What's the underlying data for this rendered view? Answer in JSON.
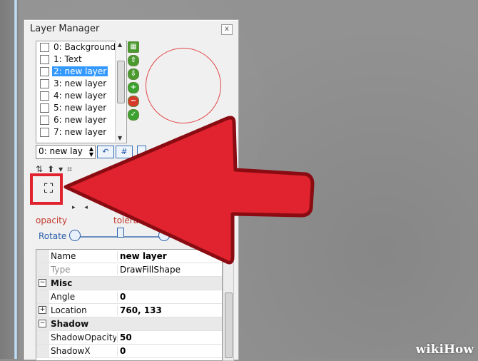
{
  "panel": {
    "title": "Layer Manager",
    "close_glyph": "x"
  },
  "layers": [
    {
      "label": "0: Background",
      "selected": false
    },
    {
      "label": "1: Text",
      "selected": false
    },
    {
      "label": "2: new layer",
      "selected": true
    },
    {
      "label": "3: new layer",
      "selected": false
    },
    {
      "label": "4: new layer",
      "selected": false
    },
    {
      "label": "5: new layer",
      "selected": false
    },
    {
      "label": "6: new layer",
      "selected": false
    },
    {
      "label": "7: new layer",
      "selected": false
    }
  ],
  "layer_select": {
    "value": "0: new lay"
  },
  "buttons": {
    "undo_glyph": "↶",
    "grid_glyph": "#"
  },
  "tools": {
    "icons": [
      "grid-green-icon",
      "arrow-up-green-icon",
      "arrow-down-green-icon",
      "plus-green-icon",
      "minus-red-icon",
      "check-green-icon"
    ],
    "colors": [
      "#4a9a2f",
      "#4a9a2f",
      "#4a9a2f",
      "#3ca22f",
      "#d83a2a",
      "#3ca22f"
    ],
    "glyphs": [
      "▦",
      "⇧",
      "⇩",
      "+",
      "−",
      "✓"
    ]
  },
  "toolbar": {
    "items": [
      "⇅",
      "⬆",
      "▾",
      "⌗"
    ]
  },
  "fill_tool": {
    "glyph": "⛶"
  },
  "labels": {
    "opacity": "opacity",
    "tolerance": "tolerance",
    "rotate": "Rotate"
  },
  "properties": [
    {
      "kind": "row",
      "name": "Name",
      "value": "new layer",
      "bold": true,
      "dim": false
    },
    {
      "kind": "row",
      "name": "Type",
      "value": "DrawFillShape",
      "bold": false,
      "dim": true
    },
    {
      "kind": "cat",
      "name": "Misc",
      "toggle": "−"
    },
    {
      "kind": "row",
      "name": "Angle",
      "value": "0",
      "bold": true,
      "dim": false
    },
    {
      "kind": "row",
      "name": "Location",
      "value": "760, 133",
      "bold": true,
      "dim": false,
      "toggle": "+"
    },
    {
      "kind": "cat",
      "name": "Shadow",
      "toggle": "−"
    },
    {
      "kind": "row",
      "name": "ShadowOpacity",
      "value": "50",
      "bold": true,
      "dim": false
    },
    {
      "kind": "row",
      "name": "ShadowX",
      "value": "0",
      "bold": true,
      "dim": false
    }
  ],
  "colors": {
    "arrow": "#e0232e",
    "selection": "#3399ff",
    "accent_label": "#c0392b",
    "rotate_blue": "#2a5ea8"
  },
  "watermark": "wikiHow"
}
